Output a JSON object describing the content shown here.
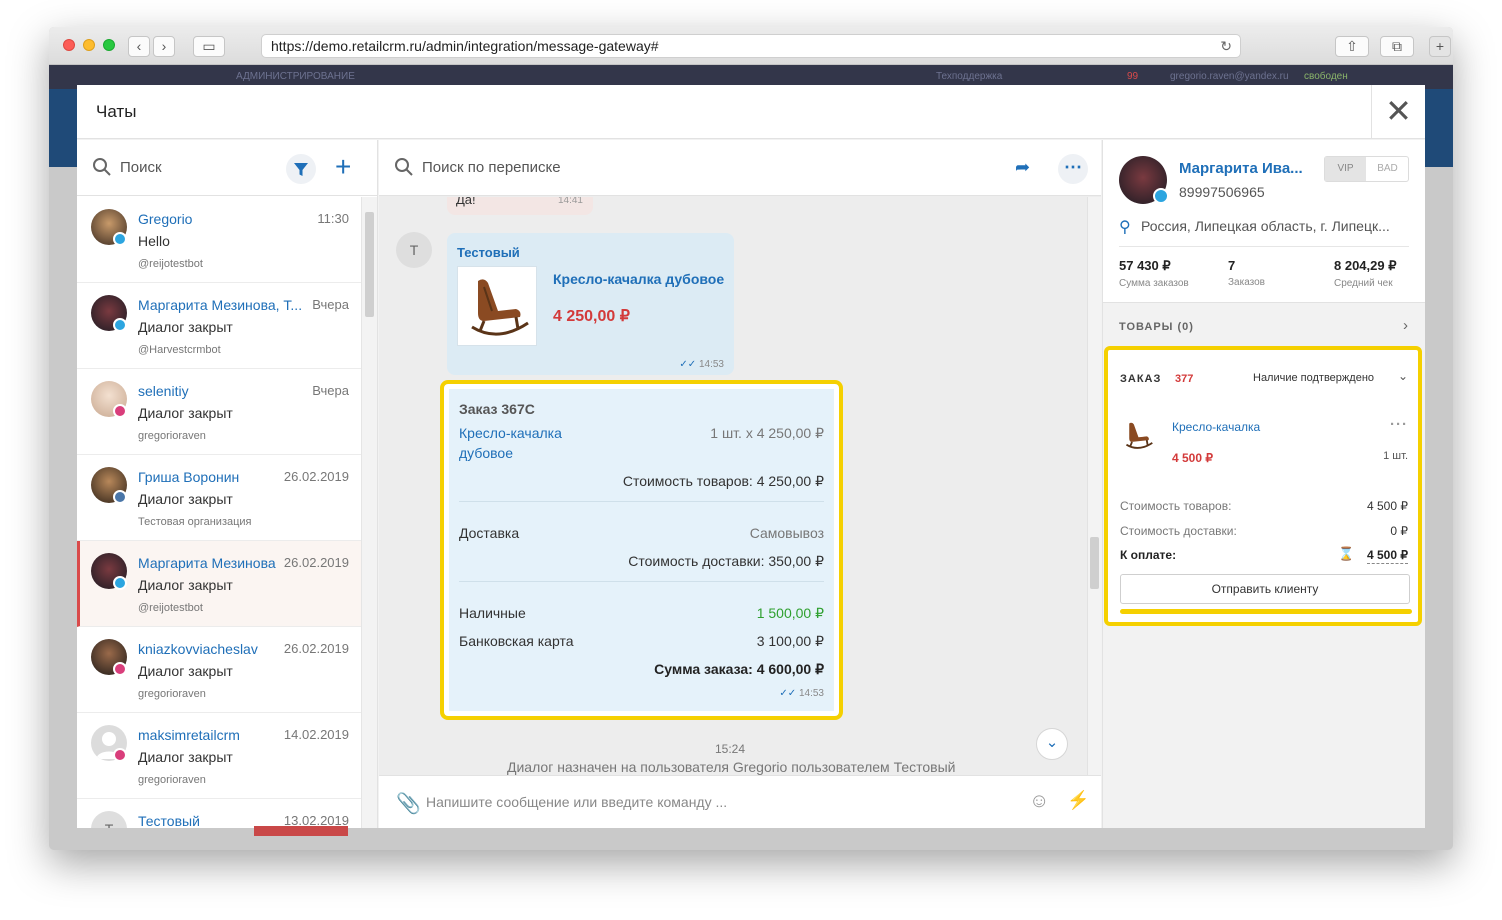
{
  "browser": {
    "url": "https://demo.retailcrm.ru/admin/integration/message-gateway#"
  },
  "appbar": {
    "admin_text": "АДМИНИСТРИРОВАНИЕ",
    "support_text": "Техподдержка",
    "notif_count": "99",
    "user_email": "gregorio.raven@yandex.ru",
    "user_status": "свободен"
  },
  "modal": {
    "title": "Чаты"
  },
  "left": {
    "search_placeholder": "Поиск",
    "chats": [
      {
        "name": "Gregorio",
        "date": "11:30",
        "message": "Hello",
        "sub": "@reijotestbot",
        "channel": "telegram"
      },
      {
        "name": "Маргарита Мезинова, Т...",
        "date": "Вчера",
        "message": "Диалог закрыт",
        "sub": "@Harvestcrmbot",
        "channel": "telegram"
      },
      {
        "name": "selenitiy",
        "date": "Вчера",
        "message": "Диалог закрыт",
        "sub": "gregorioraven",
        "channel": "instagram"
      },
      {
        "name": "Гриша Воронин",
        "date": "26.02.2019",
        "message": "Диалог закрыт",
        "sub": "Тестовая организация",
        "channel": "vk"
      },
      {
        "name": "Маргарита Мезинова",
        "date": "26.02.2019",
        "message": "Диалог закрыт",
        "sub": "@reijotestbot",
        "channel": "telegram"
      },
      {
        "name": "kniazkovviacheslav",
        "date": "26.02.2019",
        "message": "Диалог закрыт",
        "sub": "gregorioraven",
        "channel": "instagram"
      },
      {
        "name": "maksimretailcrm",
        "date": "14.02.2019",
        "message": "Диалог закрыт",
        "sub": "gregorioraven",
        "channel": "instagram"
      },
      {
        "name": "Тестовый",
        "date": "13.02.2019",
        "message": "",
        "sub": "",
        "channel": "none"
      }
    ]
  },
  "middle": {
    "search_placeholder": "Поиск по переписке",
    "top_bubble": {
      "text": "Да!",
      "time": "14:41"
    },
    "product_message": {
      "avatar_letter": "Т",
      "sender": "Тестовый",
      "title": "Кресло-качалка дубовое",
      "price": "4 250,00 ₽",
      "time": "14:53"
    },
    "order_card": {
      "title": "Заказ 367C",
      "item_name_line1": "Кресло-качалка",
      "item_name_line2": "дубовое",
      "item_qty_price": "1 шт. x 4 250,00 ₽",
      "goods_cost": "Стоимость товаров: 4 250,00 ₽",
      "delivery_label": "Доставка",
      "delivery_value": "Самовывоз",
      "delivery_cost": "Стоимость доставки: 350,00 ₽",
      "pay1_label": "Наличные",
      "pay1_value": "1 500,00 ₽",
      "pay2_label": "Банковская карта",
      "pay2_value": "3 100,00 ₽",
      "total": "Сумма заказа: 4 600,00 ₽",
      "time": "14:53"
    },
    "system": {
      "time": "15:24",
      "message": "Диалог назначен на пользователя Gregorio пользователем Тестовый"
    },
    "composer_placeholder": "Напишите сообщение или введите команду ..."
  },
  "right": {
    "client": {
      "name": "Маргарита Ива...",
      "phone": "89997506965",
      "tag_vip": "VIP",
      "tag_bad": "BAD",
      "location": "Россия, Липецкая область, г. Липецк...",
      "stats": [
        {
          "value": "57 430 ₽",
          "label": "Сумма заказов"
        },
        {
          "value": "7",
          "label": "Заказов"
        },
        {
          "value": "8 204,29 ₽",
          "label": "Средний чек"
        }
      ]
    },
    "goods_label": "ТОВАРЫ (0)",
    "order": {
      "label": "ЗАКАЗ",
      "number": "377",
      "status": "Наличие подтверждено",
      "product": "Кресло-качалка",
      "price": "4 500 ₽",
      "qty": "1 шт.",
      "goods_label": "Стоимость товаров:",
      "goods_value": "4 500 ₽",
      "delivery_label": "Стоимость доставки:",
      "delivery_value": "0 ₽",
      "topay_label": "К оплате:",
      "topay_value": "4 500 ₽",
      "send_button": "Отправить клиенту"
    }
  },
  "colors": {
    "accent": "#1f6fb8",
    "price": "#d33a3a",
    "highlight": "#f5d000",
    "paid": "#2fa02f"
  }
}
